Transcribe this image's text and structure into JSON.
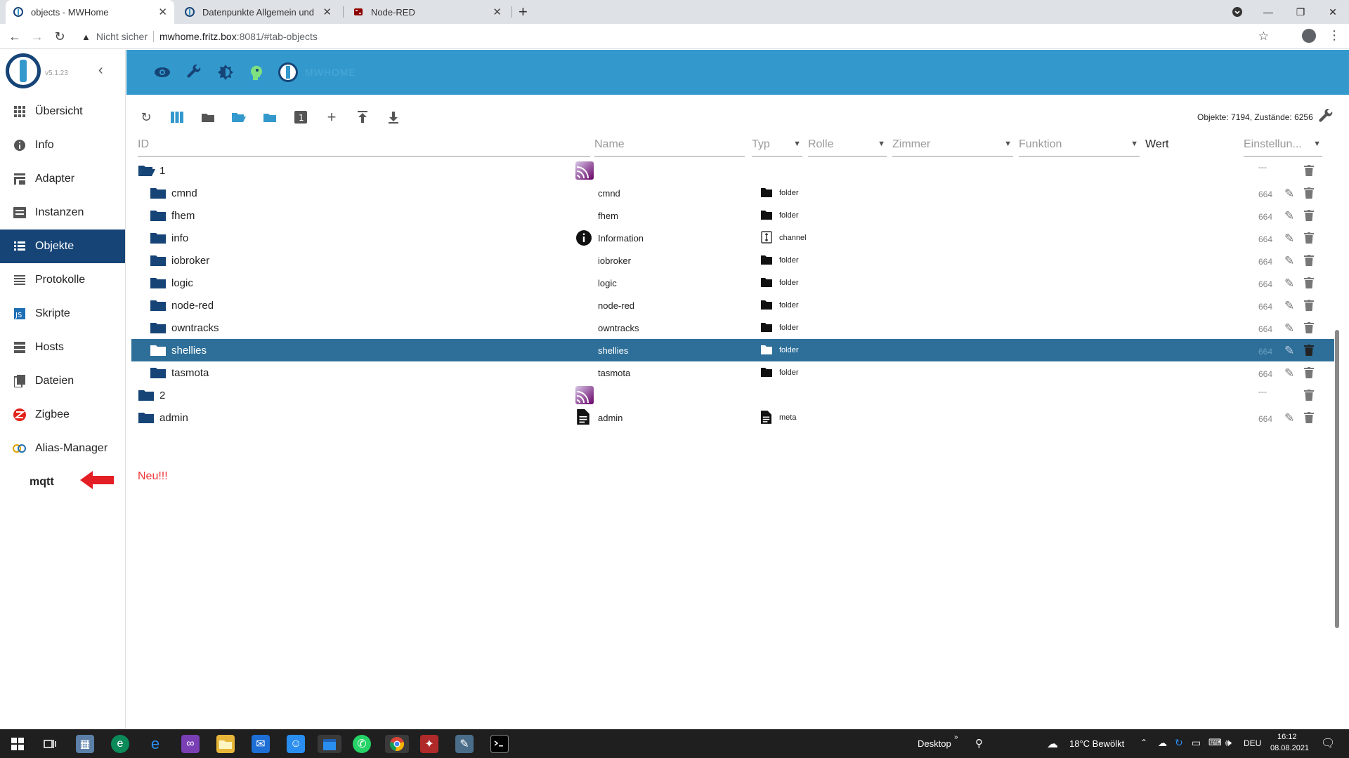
{
  "browser": {
    "tabs": [
      {
        "title": "objects - MWHome",
        "active": true
      },
      {
        "title": "Datenpunkte Allgemein und ....",
        "active": false
      },
      {
        "title": "Node-RED",
        "active": false
      }
    ],
    "address": {
      "warning": "Nicht sicher",
      "host": "mwhome.fritz.box",
      "path": ":8081/#tab-objects"
    }
  },
  "sidebar": {
    "version": "v5.1.23",
    "items": [
      {
        "label": "Übersicht",
        "icon": "grid-icon"
      },
      {
        "label": "Info",
        "icon": "info-icon"
      },
      {
        "label": "Adapter",
        "icon": "store-icon"
      },
      {
        "label": "Instanzen",
        "icon": "instances-icon"
      },
      {
        "label": "Objekte",
        "icon": "list-icon",
        "active": true
      },
      {
        "label": "Protokolle",
        "icon": "log-icon"
      },
      {
        "label": "Skripte",
        "icon": "script-icon"
      },
      {
        "label": "Hosts",
        "icon": "hosts-icon"
      },
      {
        "label": "Dateien",
        "icon": "files-icon"
      },
      {
        "label": "Zigbee",
        "icon": "zigbee-icon"
      },
      {
        "label": "Alias-Manager",
        "icon": "alias-icon"
      }
    ],
    "sub_item": "mqtt"
  },
  "header": {
    "host_name": "MWHOME"
  },
  "toolbar": {
    "stats": "Objekte: 7194, Zustände: 6256",
    "number_badge": "1"
  },
  "filters": {
    "id": "ID",
    "name": "Name",
    "type": "Typ",
    "role": "Rolle",
    "room": "Zimmer",
    "function": "Funktion",
    "value": "Wert",
    "settings": "Einstellun..."
  },
  "rows": [
    {
      "id": "1",
      "level": 0,
      "open": true,
      "name": "",
      "name_icon": "mqtt-icon",
      "type": "",
      "acl": "---"
    },
    {
      "id": "cmnd",
      "level": 1,
      "name": "cmnd",
      "type": "folder",
      "acl": "664"
    },
    {
      "id": "fhem",
      "level": 1,
      "name": "fhem",
      "type": "folder",
      "acl": "664"
    },
    {
      "id": "info",
      "level": 1,
      "name": "Information",
      "name_icon": "info-icon",
      "type": "channel",
      "acl": "664"
    },
    {
      "id": "iobroker",
      "level": 1,
      "name": "iobroker",
      "type": "folder",
      "acl": "664"
    },
    {
      "id": "logic",
      "level": 1,
      "name": "logic",
      "type": "folder",
      "acl": "664"
    },
    {
      "id": "node-red",
      "level": 1,
      "name": "node-red",
      "type": "folder",
      "acl": "664"
    },
    {
      "id": "owntracks",
      "level": 1,
      "name": "owntracks",
      "type": "folder",
      "acl": "664"
    },
    {
      "id": "shellies",
      "level": 1,
      "name": "shellies",
      "type": "folder",
      "acl": "664",
      "selected": true
    },
    {
      "id": "tasmota",
      "level": 1,
      "name": "tasmota",
      "type": "folder",
      "acl": "664"
    },
    {
      "id": "2",
      "level": 0,
      "name": "",
      "name_icon": "mqtt-icon",
      "type": "",
      "acl": "---"
    },
    {
      "id": "admin",
      "level": 0,
      "name": "admin",
      "name_icon": "document-icon",
      "type": "meta",
      "acl": "664"
    }
  ],
  "annotation": "Neu!!!",
  "taskbar": {
    "desktop": "Desktop",
    "weather": "18°C Bewölkt",
    "lang": "DEU",
    "time": "16:12",
    "date": "08.08.2021"
  },
  "colors": {
    "header_blue": "#3399cc",
    "dark_blue": "#164477",
    "selected_row": "#2e6f99",
    "annotation_red": "#e33333"
  }
}
